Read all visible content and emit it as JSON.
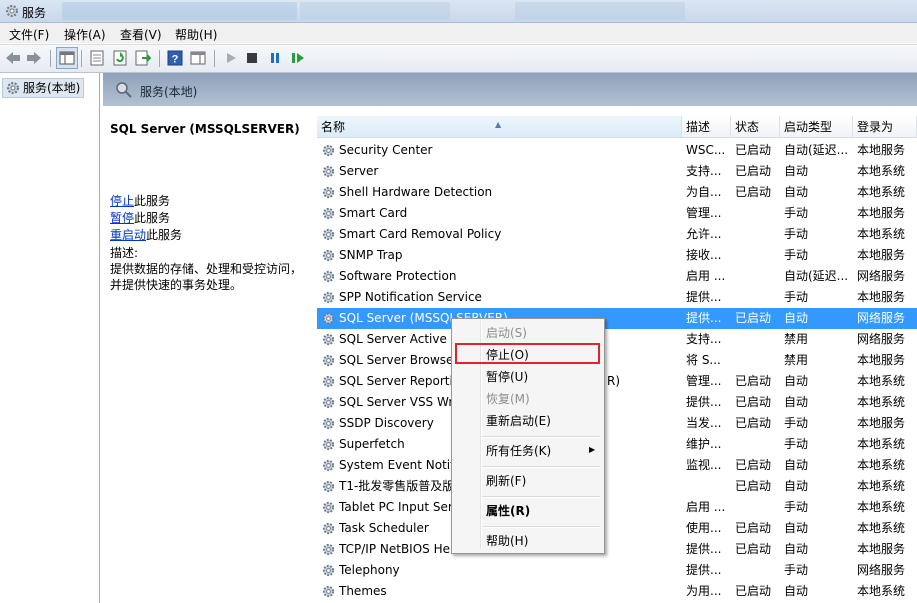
{
  "window": {
    "title": "服务"
  },
  "menu": {
    "file": "文件(F)",
    "action": "操作(A)",
    "view": "查看(V)",
    "help": "帮助(H)"
  },
  "tree": {
    "root_label": "服务(本地)"
  },
  "pane": {
    "header_title": "服务(本地)"
  },
  "detail": {
    "service_title": "SQL Server (MSSQLSERVER)",
    "stop_link": "停止",
    "stop_suffix": "此服务",
    "pause_link": "暂停",
    "pause_suffix": "此服务",
    "restart_link": "重启动",
    "restart_suffix": "此服务",
    "desc_label": "描述:",
    "desc_line1": "提供数据的存储、处理和受控访问，",
    "desc_line2": "并提供快速的事务处理。"
  },
  "columns": {
    "name": "名称",
    "desc": "描述",
    "status": "状态",
    "startup": "启动类型",
    "logon": "登录为"
  },
  "rows": [
    {
      "name": "Security Center",
      "desc": "WSC...",
      "status": "已启动",
      "startup": "自动(延迟...",
      "logon": "本地服务"
    },
    {
      "name": "Server",
      "desc": "支持...",
      "status": "已启动",
      "startup": "自动",
      "logon": "本地系统"
    },
    {
      "name": "Shell Hardware Detection",
      "desc": "为自...",
      "status": "已启动",
      "startup": "自动",
      "logon": "本地系统"
    },
    {
      "name": "Smart Card",
      "desc": "管理...",
      "status": "",
      "startup": "手动",
      "logon": "本地服务"
    },
    {
      "name": "Smart Card Removal Policy",
      "desc": "允许...",
      "status": "",
      "startup": "手动",
      "logon": "本地系统"
    },
    {
      "name": "SNMP Trap",
      "desc": "接收...",
      "status": "",
      "startup": "手动",
      "logon": "本地服务"
    },
    {
      "name": "Software Protection",
      "desc": "启用 ...",
      "status": "",
      "startup": "自动(延迟...",
      "logon": "网络服务"
    },
    {
      "name": "SPP Notification Service",
      "desc": "提供...",
      "status": "",
      "startup": "手动",
      "logon": "本地服务"
    },
    {
      "name": "SQL Server (MSSQLSERVER)",
      "desc": "提供...",
      "status": "已启动",
      "startup": "自动",
      "logon": "网络服务",
      "selected": true
    },
    {
      "name": "SQL Server Active D",
      "desc": "支持...",
      "status": "",
      "startup": "禁用",
      "logon": "网络服务"
    },
    {
      "name": "SQL Server Browse",
      "desc": "将 S...",
      "status": "",
      "startup": "禁用",
      "logon": "本地服务"
    },
    {
      "name": "SQL Server Reporti",
      "name_tail": "R)",
      "desc": "管理...",
      "status": "已启动",
      "startup": "自动",
      "logon": "本地系统"
    },
    {
      "name": "SQL Server VSS Wr",
      "desc": "提供...",
      "status": "已启动",
      "startup": "自动",
      "logon": "本地系统"
    },
    {
      "name": "SSDP Discovery",
      "desc": "当发...",
      "status": "已启动",
      "startup": "手动",
      "logon": "本地服务"
    },
    {
      "name": "Superfetch",
      "desc": "维护...",
      "status": "",
      "startup": "手动",
      "logon": "本地系统"
    },
    {
      "name": "System Event Notifi",
      "desc": "监视...",
      "status": "已启动",
      "startup": "自动",
      "logon": "本地系统"
    },
    {
      "name": "T1-批发零售版普及版",
      "desc": "",
      "status": "已启动",
      "startup": "自动",
      "logon": "本地系统"
    },
    {
      "name": "Tablet PC Input Ser",
      "desc": "启用 ...",
      "status": "",
      "startup": "手动",
      "logon": "本地系统"
    },
    {
      "name": "Task Scheduler",
      "desc": "使用...",
      "status": "已启动",
      "startup": "自动",
      "logon": "本地系统"
    },
    {
      "name": "TCP/IP NetBIOS He",
      "desc": "提供...",
      "status": "已启动",
      "startup": "自动",
      "logon": "本地服务"
    },
    {
      "name": "Telephony",
      "desc": "提供...",
      "status": "",
      "startup": "手动",
      "logon": "网络服务"
    },
    {
      "name": "Themes",
      "desc": "为用...",
      "status": "已启动",
      "startup": "自动",
      "logon": "本地系统"
    }
  ],
  "context_menu": {
    "start": "启动(S)",
    "stop": "停止(O)",
    "pause": "暂停(U)",
    "resume": "恢复(M)",
    "restart": "重新启动(E)",
    "all_tasks": "所有任务(K)",
    "refresh": "刷新(F)",
    "properties": "属性(R)",
    "help": "帮助(H)"
  },
  "colors": {
    "selection": "#3399ff",
    "highlight_box": "#e0242a",
    "link": "#0033cc"
  }
}
